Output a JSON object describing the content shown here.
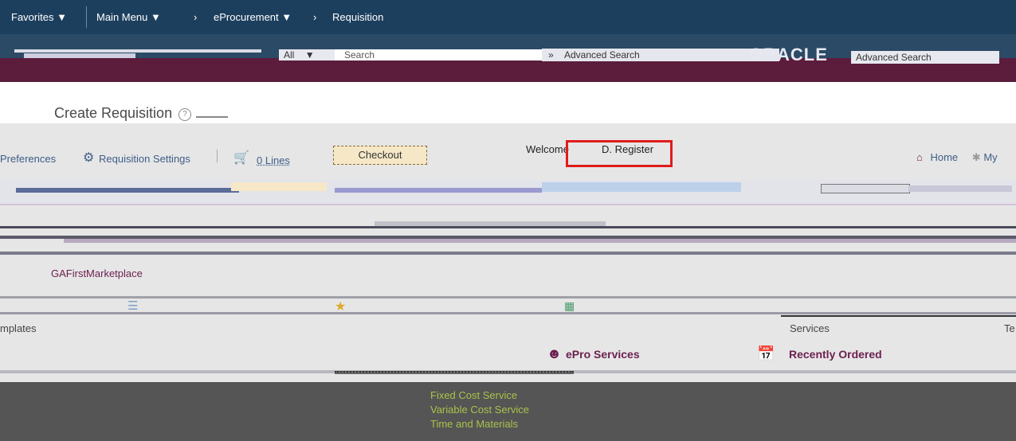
{
  "topnav": {
    "favorites": "Favorites",
    "main_menu": "Main Menu",
    "eprocurement": "eProcurement",
    "requisition": "Requisition"
  },
  "search": {
    "scope": "All",
    "placeholder": "Search",
    "advanced": "Advanced Search",
    "advanced_right": "Advanced Search"
  },
  "brand": {
    "logo_text": "ORACLE"
  },
  "page": {
    "title": "Create Requisition"
  },
  "toolbar": {
    "preferences": "Preferences",
    "requisition_settings": "Requisition Settings",
    "lines": "0 Lines",
    "checkout": "Checkout",
    "welcome": "Welcome",
    "user": "D. Register",
    "home": "Home",
    "my": "My"
  },
  "links": {
    "marketplace": "GAFirstMarketplace",
    "templates_left": "mplates",
    "services": "Services",
    "te": "Te",
    "epro_services": "ePro Services",
    "recently_ordered": "Recently Ordered"
  },
  "service_items": [
    "Fixed Cost Service",
    "Variable Cost Service",
    "Time and Materials"
  ],
  "colors": {
    "nav": "#1d3f5e",
    "accent": "#6b1f4e",
    "highlight": "#e01b1b"
  }
}
